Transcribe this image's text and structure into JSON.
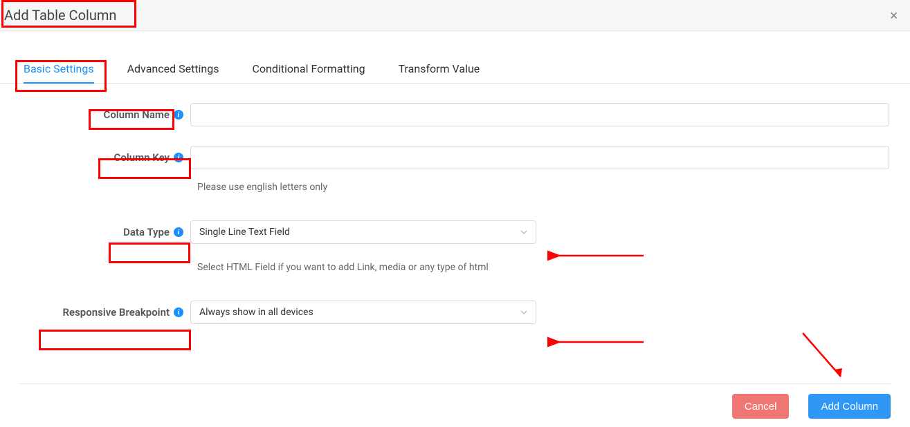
{
  "header": {
    "title": "Add Table Column"
  },
  "tabs": {
    "basic": "Basic Settings",
    "advanced": "Advanced Settings",
    "formatting": "Conditional Formatting",
    "transform": "Transform Value"
  },
  "fields": {
    "column_name": {
      "label": "Column Name",
      "value": ""
    },
    "column_key": {
      "label": "Column Key",
      "value": "",
      "helper": "Please use english letters only"
    },
    "data_type": {
      "label": "Data Type",
      "selected": "Single Line Text Field",
      "helper": "Select HTML Field if you want to add Link, media or any type of html"
    },
    "responsive": {
      "label": "Responsive Breakpoint",
      "selected": "Always show in all devices"
    }
  },
  "buttons": {
    "cancel": "Cancel",
    "submit": "Add Column"
  }
}
